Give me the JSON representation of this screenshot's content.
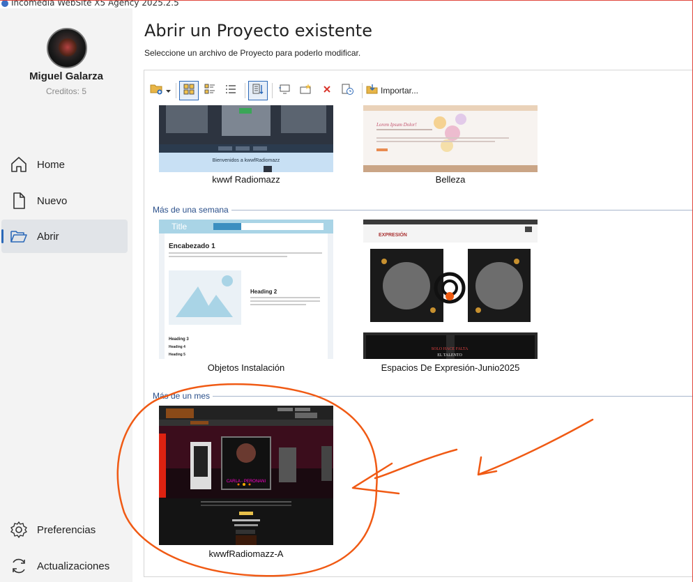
{
  "window": {
    "title": "Incomedia WebSite X5 Agency 2025.2.5"
  },
  "user": {
    "name": "Miguel Galarza",
    "credits": "Creditos: 5"
  },
  "nav": {
    "home": "Home",
    "new": "Nuevo",
    "open": "Abrir",
    "preferences": "Preferencias",
    "updates": "Actualizaciones"
  },
  "page": {
    "title": "Abrir un Proyecto existente",
    "subtitle": "Seleccione un archivo de Proyecto para poderlo modificar."
  },
  "toolbar": {
    "import_label": "Importar..."
  },
  "groups": {
    "recent": {
      "projects": [
        {
          "name": "kwwf Radiomazz",
          "thumb_text": "Bienvenidos a kwwfRadiomazz"
        },
        {
          "name": "Belleza",
          "thumb_text": "Lorem Ipsum Dolor!"
        }
      ]
    },
    "week": {
      "label": "Más de una semana",
      "projects": [
        {
          "name": "Objetos Instalación",
          "thumb_title": "Title",
          "thumb_h1": "Encabezado 1",
          "thumb_h2": "Heading 2",
          "thumb_h3": "Heading 3",
          "thumb_h4": "Heading 4",
          "thumb_h5": "Heading 5"
        },
        {
          "name": "Espacios De Expresión-Junio2025",
          "thumb_logo": "EXPRESIÓN",
          "thumb_banner1": "SOLO HACE FALTA",
          "thumb_banner2": "EL TALENTO"
        }
      ]
    },
    "month": {
      "label": "Más de un mes",
      "projects": [
        {
          "name": "kwwfRadiomazz-A",
          "thumb_caption": "CARLA - PERONANI"
        }
      ]
    }
  },
  "colors": {
    "accent": "#2a68b8",
    "annotation": "#f05a14",
    "group_header": "#2a4f8a"
  }
}
